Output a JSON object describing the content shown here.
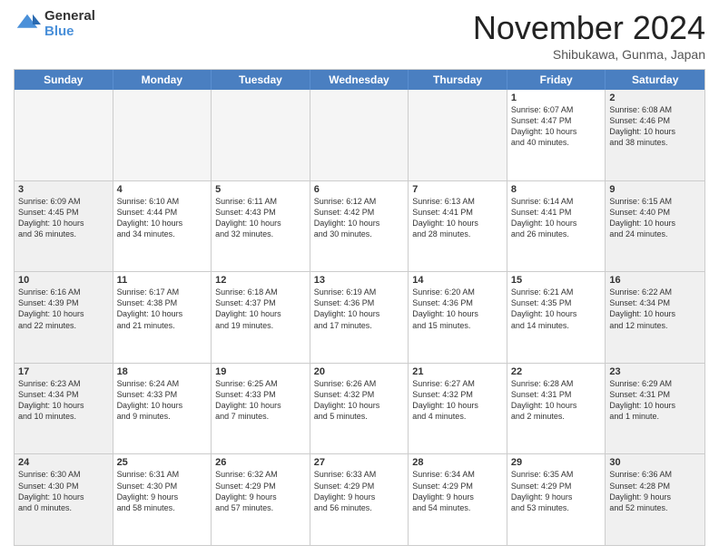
{
  "logo": {
    "general": "General",
    "blue": "Blue"
  },
  "header": {
    "title": "November 2024",
    "location": "Shibukawa, Gunma, Japan"
  },
  "days": [
    "Sunday",
    "Monday",
    "Tuesday",
    "Wednesday",
    "Thursday",
    "Friday",
    "Saturday"
  ],
  "rows": [
    [
      {
        "day": "",
        "info": "",
        "empty": true
      },
      {
        "day": "",
        "info": "",
        "empty": true
      },
      {
        "day": "",
        "info": "",
        "empty": true
      },
      {
        "day": "",
        "info": "",
        "empty": true
      },
      {
        "day": "",
        "info": "",
        "empty": true
      },
      {
        "day": "1",
        "info": "Sunrise: 6:07 AM\nSunset: 4:47 PM\nDaylight: 10 hours\nand 40 minutes."
      },
      {
        "day": "2",
        "info": "Sunrise: 6:08 AM\nSunset: 4:46 PM\nDaylight: 10 hours\nand 38 minutes."
      }
    ],
    [
      {
        "day": "3",
        "info": "Sunrise: 6:09 AM\nSunset: 4:45 PM\nDaylight: 10 hours\nand 36 minutes."
      },
      {
        "day": "4",
        "info": "Sunrise: 6:10 AM\nSunset: 4:44 PM\nDaylight: 10 hours\nand 34 minutes."
      },
      {
        "day": "5",
        "info": "Sunrise: 6:11 AM\nSunset: 4:43 PM\nDaylight: 10 hours\nand 32 minutes."
      },
      {
        "day": "6",
        "info": "Sunrise: 6:12 AM\nSunset: 4:42 PM\nDaylight: 10 hours\nand 30 minutes."
      },
      {
        "day": "7",
        "info": "Sunrise: 6:13 AM\nSunset: 4:41 PM\nDaylight: 10 hours\nand 28 minutes."
      },
      {
        "day": "8",
        "info": "Sunrise: 6:14 AM\nSunset: 4:41 PM\nDaylight: 10 hours\nand 26 minutes."
      },
      {
        "day": "9",
        "info": "Sunrise: 6:15 AM\nSunset: 4:40 PM\nDaylight: 10 hours\nand 24 minutes."
      }
    ],
    [
      {
        "day": "10",
        "info": "Sunrise: 6:16 AM\nSunset: 4:39 PM\nDaylight: 10 hours\nand 22 minutes."
      },
      {
        "day": "11",
        "info": "Sunrise: 6:17 AM\nSunset: 4:38 PM\nDaylight: 10 hours\nand 21 minutes."
      },
      {
        "day": "12",
        "info": "Sunrise: 6:18 AM\nSunset: 4:37 PM\nDaylight: 10 hours\nand 19 minutes."
      },
      {
        "day": "13",
        "info": "Sunrise: 6:19 AM\nSunset: 4:36 PM\nDaylight: 10 hours\nand 17 minutes."
      },
      {
        "day": "14",
        "info": "Sunrise: 6:20 AM\nSunset: 4:36 PM\nDaylight: 10 hours\nand 15 minutes."
      },
      {
        "day": "15",
        "info": "Sunrise: 6:21 AM\nSunset: 4:35 PM\nDaylight: 10 hours\nand 14 minutes."
      },
      {
        "day": "16",
        "info": "Sunrise: 6:22 AM\nSunset: 4:34 PM\nDaylight: 10 hours\nand 12 minutes."
      }
    ],
    [
      {
        "day": "17",
        "info": "Sunrise: 6:23 AM\nSunset: 4:34 PM\nDaylight: 10 hours\nand 10 minutes."
      },
      {
        "day": "18",
        "info": "Sunrise: 6:24 AM\nSunset: 4:33 PM\nDaylight: 10 hours\nand 9 minutes."
      },
      {
        "day": "19",
        "info": "Sunrise: 6:25 AM\nSunset: 4:33 PM\nDaylight: 10 hours\nand 7 minutes."
      },
      {
        "day": "20",
        "info": "Sunrise: 6:26 AM\nSunset: 4:32 PM\nDaylight: 10 hours\nand 5 minutes."
      },
      {
        "day": "21",
        "info": "Sunrise: 6:27 AM\nSunset: 4:32 PM\nDaylight: 10 hours\nand 4 minutes."
      },
      {
        "day": "22",
        "info": "Sunrise: 6:28 AM\nSunset: 4:31 PM\nDaylight: 10 hours\nand 2 minutes."
      },
      {
        "day": "23",
        "info": "Sunrise: 6:29 AM\nSunset: 4:31 PM\nDaylight: 10 hours\nand 1 minute."
      }
    ],
    [
      {
        "day": "24",
        "info": "Sunrise: 6:30 AM\nSunset: 4:30 PM\nDaylight: 10 hours\nand 0 minutes."
      },
      {
        "day": "25",
        "info": "Sunrise: 6:31 AM\nSunset: 4:30 PM\nDaylight: 9 hours\nand 58 minutes."
      },
      {
        "day": "26",
        "info": "Sunrise: 6:32 AM\nSunset: 4:29 PM\nDaylight: 9 hours\nand 57 minutes."
      },
      {
        "day": "27",
        "info": "Sunrise: 6:33 AM\nSunset: 4:29 PM\nDaylight: 9 hours\nand 56 minutes."
      },
      {
        "day": "28",
        "info": "Sunrise: 6:34 AM\nSunset: 4:29 PM\nDaylight: 9 hours\nand 54 minutes."
      },
      {
        "day": "29",
        "info": "Sunrise: 6:35 AM\nSunset: 4:29 PM\nDaylight: 9 hours\nand 53 minutes."
      },
      {
        "day": "30",
        "info": "Sunrise: 6:36 AM\nSunset: 4:28 PM\nDaylight: 9 hours\nand 52 minutes."
      }
    ]
  ]
}
